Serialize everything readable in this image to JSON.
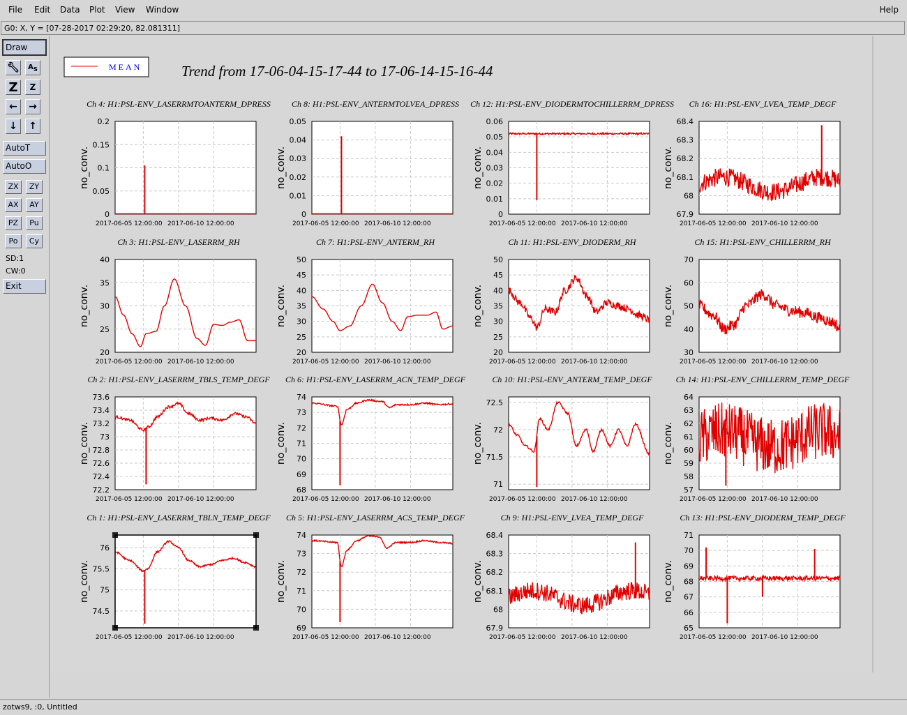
{
  "menu": {
    "file": "File",
    "edit": "Edit",
    "data": "Data",
    "plot": "Plot",
    "view": "View",
    "window": "Window",
    "help": "Help"
  },
  "coord_readout": "G0: X, Y = [07-28-2017 02:29:20, 82.081311]",
  "toolbar": {
    "draw": "Draw",
    "autot": "AutoT",
    "autoo": "AutoO",
    "zx": "ZX",
    "zy": "ZY",
    "ax": "AX",
    "ay": "AY",
    "pz": "PZ",
    "pu": "Pu",
    "po": "Po",
    "cy": "Cy",
    "sd": "SD:1",
    "cw": "CW:0",
    "exit": "Exit"
  },
  "status": "zotws9, :0, Untitled",
  "legend": {
    "label": "MEAN",
    "color": "#e00000"
  },
  "chart_title": "Trend from 17-06-04-15-17-44 to 17-06-14-15-16-44",
  "ylabel": "no_conv.",
  "xticks": [
    "2017-06-05 12:00:00",
    "2017-06-10 12:00:00"
  ],
  "chart_data": [
    {
      "type": "line",
      "title": "Ch 4: H1:PSL-ENV_LASERRMTOANTERM_DPRESS",
      "ylabel": "no_conv.",
      "ylim": [
        0,
        0.2
      ],
      "yticks": [
        "0.2",
        "0.15",
        "0.1",
        "0.05",
        "0"
      ],
      "shape": "spike",
      "series": [
        {
          "name": "MEAN",
          "baseline": 0.0,
          "spikes": [
            [
              0.21,
              0.105
            ]
          ]
        }
      ]
    },
    {
      "type": "line",
      "title": "Ch 8: H1:PSL-ENV_ANTERMTOLVEA_DPRESS",
      "ylabel": "no_conv.",
      "ylim": [
        0,
        0.05
      ],
      "yticks": [
        "0.05",
        "0.04",
        "0.03",
        "0.02",
        "0.01",
        "0"
      ],
      "shape": "spike",
      "series": [
        {
          "name": "MEAN",
          "baseline": 0.0,
          "spikes": [
            [
              0.21,
              0.042
            ]
          ]
        }
      ]
    },
    {
      "type": "line",
      "title": "Ch 12: H1:PSL-ENV_DIODERMTOCHILLERRM_DPRESS",
      "ylabel": "no_conv.",
      "ylim": [
        0,
        0.06
      ],
      "yticks": [
        "0.06",
        "0.05",
        "0.04",
        "0.03",
        "0.02",
        "0.01",
        "0"
      ],
      "shape": "flat",
      "series": [
        {
          "name": "MEAN",
          "base": 0.052,
          "noise": 0.0006,
          "dips": [
            [
              0.2,
              0.009
            ]
          ]
        }
      ]
    },
    {
      "type": "line",
      "title": "Ch 16: H1:PSL-ENV_LVEA_TEMP_DEGF",
      "ylabel": "no_conv.",
      "ylim": [
        67.9,
        68.4
      ],
      "yticks": [
        "68.4",
        "68.3",
        "68.2",
        "68.1",
        "68",
        "67.9"
      ],
      "shape": "noisy",
      "series": [
        {
          "name": "MEAN",
          "base": 68.06,
          "amp": 0.04,
          "noise": 0.05,
          "spikes": [
            [
              0.87,
              68.38
            ]
          ]
        }
      ]
    },
    {
      "type": "line",
      "title": "Ch 3: H1:PSL-ENV_LASERRM_RH",
      "ylabel": "no_conv.",
      "ylim": [
        20,
        40
      ],
      "yticks": [
        "40",
        "35",
        "30",
        "25",
        "20"
      ],
      "shape": "smooth",
      "series": [
        {
          "name": "MEAN",
          "points": [
            [
              0,
              32
            ],
            [
              0.06,
              28
            ],
            [
              0.12,
              24
            ],
            [
              0.18,
              21.2
            ],
            [
              0.22,
              24
            ],
            [
              0.29,
              24.5
            ],
            [
              0.35,
              30
            ],
            [
              0.42,
              35.8
            ],
            [
              0.5,
              30
            ],
            [
              0.58,
              23
            ],
            [
              0.64,
              21.5
            ],
            [
              0.7,
              26
            ],
            [
              0.76,
              25.8
            ],
            [
              0.82,
              26.5
            ],
            [
              0.88,
              27
            ],
            [
              0.94,
              22.5
            ],
            [
              1,
              22.5
            ]
          ]
        }
      ]
    },
    {
      "type": "line",
      "title": "Ch 7: H1:PSL-ENV_ANTERM_RH",
      "ylabel": "no_conv.",
      "ylim": [
        20,
        50
      ],
      "yticks": [
        "50",
        "45",
        "40",
        "35",
        "30",
        "25",
        "20"
      ],
      "shape": "smooth",
      "series": [
        {
          "name": "MEAN",
          "points": [
            [
              0,
              38
            ],
            [
              0.08,
              34
            ],
            [
              0.15,
              30
            ],
            [
              0.2,
              27
            ],
            [
              0.27,
              28.5
            ],
            [
              0.35,
              35
            ],
            [
              0.43,
              42
            ],
            [
              0.5,
              36
            ],
            [
              0.57,
              30
            ],
            [
              0.63,
              27
            ],
            [
              0.68,
              31.5
            ],
            [
              0.75,
              32
            ],
            [
              0.82,
              32
            ],
            [
              0.88,
              33
            ],
            [
              0.93,
              27.5
            ],
            [
              1,
              28.5
            ]
          ]
        }
      ]
    },
    {
      "type": "line",
      "title": "Ch 11: H1:PSL-ENV_DIODERM_RH",
      "ylabel": "no_conv.",
      "ylim": [
        20,
        50
      ],
      "yticks": [
        "50",
        "45",
        "40",
        "35",
        "30",
        "25",
        "20"
      ],
      "shape": "smooth",
      "series": [
        {
          "name": "MEAN",
          "noise": 1.2,
          "points": [
            [
              0,
              40
            ],
            [
              0.08,
              36
            ],
            [
              0.16,
              31
            ],
            [
              0.2,
              28
            ],
            [
              0.26,
              34
            ],
            [
              0.33,
              33
            ],
            [
              0.4,
              40
            ],
            [
              0.48,
              44
            ],
            [
              0.56,
              38
            ],
            [
              0.62,
              33
            ],
            [
              0.7,
              36
            ],
            [
              0.78,
              35
            ],
            [
              0.85,
              34
            ],
            [
              0.92,
              32
            ],
            [
              1,
              30.5
            ]
          ]
        }
      ]
    },
    {
      "type": "line",
      "title": "Ch 15: H1:PSL-ENV_CHILLERRM_RH",
      "ylabel": "no_conv.",
      "ylim": [
        30,
        70
      ],
      "yticks": [
        "70",
        "60",
        "50",
        "40",
        "30"
      ],
      "shape": "smooth",
      "series": [
        {
          "name": "MEAN",
          "noise": 2.5,
          "points": [
            [
              0,
              50
            ],
            [
              0.1,
              46
            ],
            [
              0.18,
              40
            ],
            [
              0.25,
              42
            ],
            [
              0.33,
              50
            ],
            [
              0.45,
              55
            ],
            [
              0.55,
              50
            ],
            [
              0.65,
              48
            ],
            [
              0.75,
              47
            ],
            [
              0.85,
              45
            ],
            [
              0.95,
              43
            ],
            [
              1,
              40
            ]
          ]
        }
      ]
    },
    {
      "type": "line",
      "title": "Ch 2: H1:PSL-ENV_LASERRM_TBLS_TEMP_DEGF",
      "ylabel": "no_conv.",
      "ylim": [
        72.2,
        73.6
      ],
      "yticks": [
        "73.6",
        "73.4",
        "73.2",
        "73",
        "72.8",
        "72.6",
        "72.4",
        "72.2"
      ],
      "shape": "smooth",
      "series": [
        {
          "name": "MEAN",
          "noise": 0.02,
          "dips": [
            [
              0.22,
              72.28
            ]
          ],
          "points": [
            [
              0,
              73.3
            ],
            [
              0.1,
              73.25
            ],
            [
              0.2,
              73.1
            ],
            [
              0.24,
              73.15
            ],
            [
              0.3,
              73.3
            ],
            [
              0.38,
              73.45
            ],
            [
              0.45,
              73.5
            ],
            [
              0.52,
              73.35
            ],
            [
              0.6,
              73.25
            ],
            [
              0.68,
              73.28
            ],
            [
              0.76,
              73.25
            ],
            [
              0.85,
              73.35
            ],
            [
              0.93,
              73.3
            ],
            [
              1,
              73.2
            ]
          ]
        }
      ]
    },
    {
      "type": "line",
      "title": "Ch 6: H1:PSL-ENV_LASERRM_ACN_TEMP_DEGF",
      "ylabel": "no_conv.",
      "ylim": [
        68,
        74
      ],
      "yticks": [
        "74",
        "73",
        "72",
        "71",
        "70",
        "69",
        "68"
      ],
      "shape": "smooth",
      "series": [
        {
          "name": "MEAN",
          "noise": 0.05,
          "dips": [
            [
              0.2,
              68.3
            ]
          ],
          "points": [
            [
              0,
              73.6
            ],
            [
              0.18,
              73.4
            ],
            [
              0.21,
              72.2
            ],
            [
              0.25,
              73.2
            ],
            [
              0.32,
              73.6
            ],
            [
              0.4,
              73.8
            ],
            [
              0.5,
              73.7
            ],
            [
              0.55,
              73.3
            ],
            [
              0.6,
              73.5
            ],
            [
              0.7,
              73.5
            ],
            [
              0.8,
              73.6
            ],
            [
              0.9,
              73.5
            ],
            [
              1,
              73.55
            ]
          ]
        }
      ]
    },
    {
      "type": "line",
      "title": "Ch 10: H1:PSL-ENV_ANTERM_TEMP_DEGF",
      "ylabel": "no_conv.",
      "ylim": [
        70.9,
        72.6
      ],
      "yticks": [
        "72.5",
        "72",
        "71.5",
        "71"
      ],
      "shape": "smooth",
      "series": [
        {
          "name": "MEAN",
          "noise": 0.02,
          "dips": [
            [
              0.2,
              70.95
            ]
          ],
          "points": [
            [
              0,
              72.1
            ],
            [
              0.06,
              71.9
            ],
            [
              0.12,
              71.7
            ],
            [
              0.18,
              71.6
            ],
            [
              0.22,
              72.2
            ],
            [
              0.28,
              72.0
            ],
            [
              0.35,
              72.5
            ],
            [
              0.42,
              72.3
            ],
            [
              0.48,
              71.7
            ],
            [
              0.55,
              72.0
            ],
            [
              0.6,
              71.6
            ],
            [
              0.66,
              72.0
            ],
            [
              0.72,
              71.7
            ],
            [
              0.78,
              72.0
            ],
            [
              0.84,
              71.7
            ],
            [
              0.9,
              72.1
            ],
            [
              1,
              71.55
            ]
          ]
        }
      ]
    },
    {
      "type": "line",
      "title": "Ch 14: H1:PSL-ENV_CHILLERRM_TEMP_DEGF",
      "ylabel": "no_conv.",
      "ylim": [
        57,
        64
      ],
      "yticks": [
        "64",
        "63",
        "62",
        "61",
        "60",
        "59",
        "58",
        "57"
      ],
      "shape": "noisy",
      "series": [
        {
          "name": "MEAN",
          "base": 60.8,
          "amp": 0.6,
          "noise": 2.2,
          "spikes": [
            [
              0.19,
              57.3
            ]
          ]
        }
      ]
    },
    {
      "type": "line",
      "title": "Ch 1: H1:PSL-ENV_LASERRM_TBLN_TEMP_DEGF",
      "ylabel": "no_conv.",
      "ylim": [
        74.1,
        76.3
      ],
      "yticks": [
        "76",
        "75.5",
        "75",
        "74.5"
      ],
      "shape": "smooth",
      "series": [
        {
          "name": "MEAN",
          "noise": 0.02,
          "dips": [
            [
              0.21,
              74.2
            ]
          ],
          "points": [
            [
              0,
              75.9
            ],
            [
              0.1,
              75.7
            ],
            [
              0.2,
              75.45
            ],
            [
              0.23,
              75.5
            ],
            [
              0.3,
              75.9
            ],
            [
              0.38,
              76.15
            ],
            [
              0.45,
              76.0
            ],
            [
              0.52,
              75.7
            ],
            [
              0.6,
              75.55
            ],
            [
              0.68,
              75.6
            ],
            [
              0.76,
              75.7
            ],
            [
              0.84,
              75.75
            ],
            [
              0.92,
              75.65
            ],
            [
              1,
              75.55
            ]
          ]
        }
      ]
    },
    {
      "type": "line",
      "title": "Ch 5: H1:PSL-ENV_LASERRM_ACS_TEMP_DEGF",
      "ylabel": "no_conv.",
      "ylim": [
        69,
        74
      ],
      "yticks": [
        "74",
        "73",
        "72",
        "71",
        "70",
        "69"
      ],
      "shape": "smooth",
      "series": [
        {
          "name": "MEAN",
          "noise": 0.04,
          "dips": [
            [
              0.2,
              69.3
            ]
          ],
          "points": [
            [
              0,
              73.7
            ],
            [
              0.18,
              73.6
            ],
            [
              0.21,
              72.3
            ],
            [
              0.25,
              73.2
            ],
            [
              0.32,
              73.7
            ],
            [
              0.4,
              73.95
            ],
            [
              0.48,
              73.9
            ],
            [
              0.53,
              73.3
            ],
            [
              0.6,
              73.6
            ],
            [
              0.7,
              73.6
            ],
            [
              0.8,
              73.7
            ],
            [
              0.9,
              73.6
            ],
            [
              1,
              73.55
            ]
          ]
        }
      ]
    },
    {
      "type": "line",
      "title": "Ch 9: H1:PSL-ENV_LVEA_TEMP_DEGF",
      "ylabel": "no_conv.",
      "ylim": [
        67.9,
        68.4
      ],
      "yticks": [
        "68.4",
        "68.3",
        "68.2",
        "68.1",
        "68",
        "67.9"
      ],
      "shape": "noisy",
      "series": [
        {
          "name": "MEAN",
          "base": 68.06,
          "amp": 0.04,
          "noise": 0.05,
          "spikes": [
            [
              0.9,
              68.36
            ]
          ]
        }
      ]
    },
    {
      "type": "line",
      "title": "Ch 13: H1:PSL-ENV_DIODERM_TEMP_DEGF",
      "ylabel": "no_conv.",
      "ylim": [
        65,
        71
      ],
      "yticks": [
        "71",
        "70",
        "69",
        "68",
        "67",
        "66",
        "65"
      ],
      "shape": "flat",
      "series": [
        {
          "name": "MEAN",
          "base": 68.2,
          "noise": 0.15,
          "spikes": [
            [
              0.05,
              70.2
            ],
            [
              0.82,
              70.1
            ]
          ],
          "dips": [
            [
              0.2,
              65.3
            ],
            [
              0.45,
              67.0
            ]
          ]
        }
      ]
    }
  ]
}
